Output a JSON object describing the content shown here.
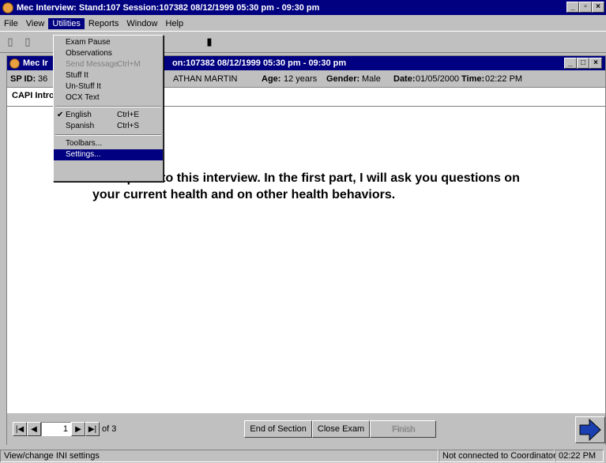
{
  "window": {
    "title": "Mec Interview: Stand:107 Session:107382 08/12/1999 05:30 pm - 09:30 pm"
  },
  "menubar": {
    "items": [
      "File",
      "View",
      "Utilities",
      "Reports",
      "Window",
      "Help"
    ]
  },
  "utilities_menu": {
    "items": [
      {
        "label": "Exam Pause",
        "shortcut": ""
      },
      {
        "label": "Observations",
        "shortcut": ""
      },
      {
        "label": "Send Message",
        "shortcut": "Ctrl+M",
        "disabled": true
      },
      {
        "label": "Stuff It",
        "shortcut": ""
      },
      {
        "label": "Un-Stuff It",
        "shortcut": ""
      },
      {
        "label": "OCX Text",
        "shortcut": ""
      },
      {
        "label": "English",
        "shortcut": "Ctrl+E",
        "checked": true
      },
      {
        "label": "Spanish",
        "shortcut": "Ctrl+S"
      },
      {
        "label": "Toolbars...",
        "shortcut": ""
      },
      {
        "label": "Settings...",
        "shortcut": "",
        "selected": true
      }
    ]
  },
  "child": {
    "title_left": "Mec Ir",
    "title_right": "on:107382 08/12/1999 05:30 pm - 09:30 pm",
    "info": {
      "sp_label": "SP ID:",
      "sp_value": "36",
      "name": "ATHAN MARTIN",
      "age_label": "Age:",
      "age_value": "12 years",
      "gender_label": "Gender:",
      "gender_value": "Male",
      "date_label": "Date:",
      "date_value": "01/05/2000",
      "time_label": "Time:",
      "time_value": "02:22 PM"
    },
    "tab": "CAPI Intro",
    "question": "three parts to this interview.  In the first part, I will ask you questions on your current health and on other health behaviors."
  },
  "navigation": {
    "page": "1",
    "of": "of 3",
    "end_section": "End of Section",
    "close_exam": "Close Exam",
    "finish": "Finish"
  },
  "status": {
    "hint": "View/change INI settings",
    "connection": "Not connected to Coordinator",
    "time": "02:22 PM"
  }
}
